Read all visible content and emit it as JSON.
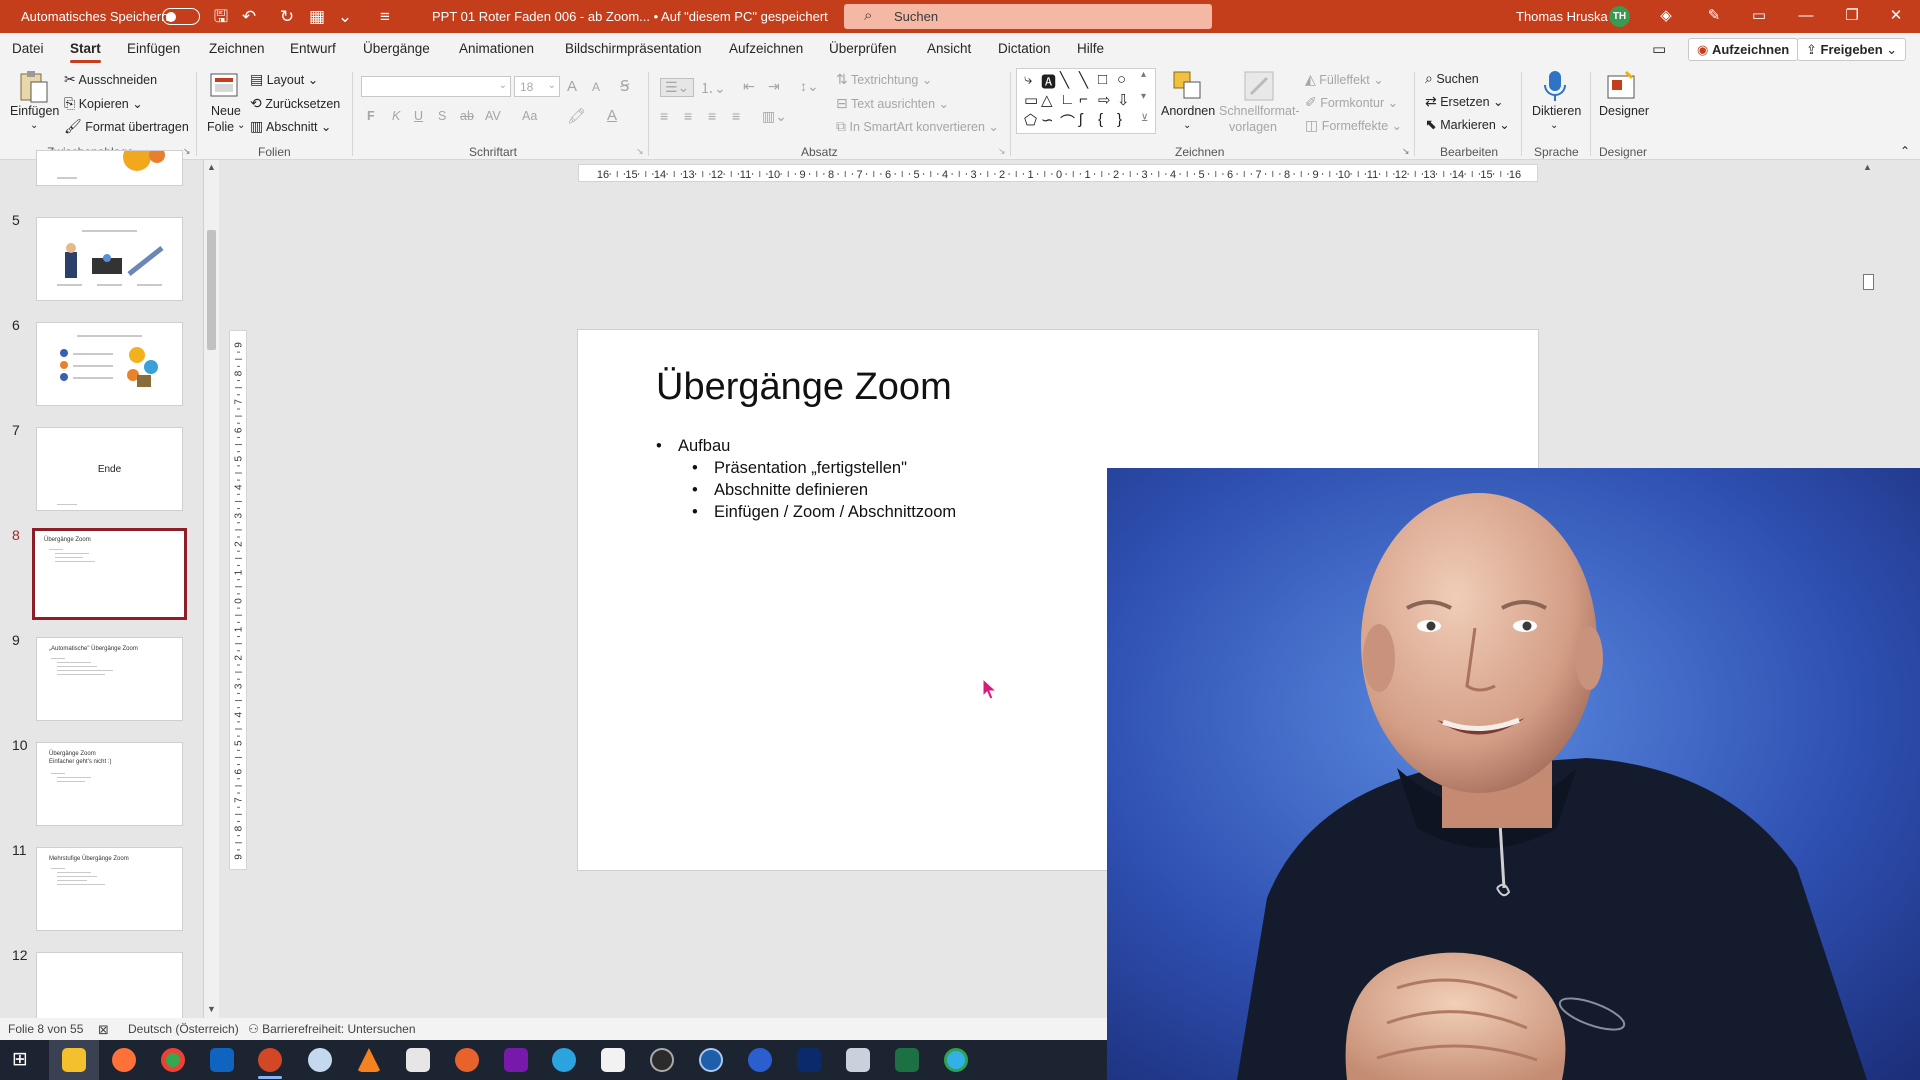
{
  "titlebar": {
    "autosave_label": "Automatisches Speichern",
    "document_title": "PPT 01 Roter Faden 006 - ab Zoom... • Auf \"diesem PC\" gespeichert",
    "search_placeholder": "Suchen",
    "user_name": "Thomas Hruska",
    "user_initials": "TH",
    "accent_color": "#c43e1c"
  },
  "menu": {
    "tabs": [
      "Datei",
      "Start",
      "Einfügen",
      "Zeichnen",
      "Entwurf",
      "Übergänge",
      "Animationen",
      "Bildschirmpräsentation",
      "Aufzeichnen",
      "Überprüfen",
      "Ansicht",
      "Dictation",
      "Hilfe"
    ],
    "active_tab": "Start",
    "record_button": "Aufzeichnen",
    "share_button": "Freigeben"
  },
  "ribbon": {
    "clipboard": {
      "paste": "Einfügen",
      "cut": "Ausschneiden",
      "copy": "Kopieren",
      "format_painter": "Format übertragen",
      "group": "Zwischenablage"
    },
    "slides": {
      "new_slide_1": "Neue",
      "new_slide_2": "Folie",
      "layout": "Layout",
      "reset": "Zurücksetzen",
      "section": "Abschnitt",
      "group": "Folien"
    },
    "font": {
      "size": "18",
      "bold": "F",
      "italic": "K",
      "underline": "U",
      "shadow": "S",
      "strike": "ab",
      "spacing": "AV",
      "case": "Aa",
      "grow": "A",
      "shrink": "A",
      "group": "Schriftart"
    },
    "paragraph": {
      "text_direction": "Textrichtung",
      "align_text": "Text ausrichten",
      "smartart": "In SmartArt konvertieren",
      "group": "Absatz"
    },
    "drawing": {
      "arrange": "Anordnen",
      "quick_styles_1": "Schnellformat-",
      "quick_styles_2": "vorlagen",
      "fill": "Fülleffekt",
      "outline": "Formkontur",
      "effects": "Formeffekte",
      "group": "Zeichnen"
    },
    "editing": {
      "find": "Suchen",
      "replace": "Ersetzen",
      "select": "Markieren",
      "group": "Bearbeiten"
    },
    "voice": {
      "dictate": "Diktieren",
      "group": "Sprache"
    },
    "designer": {
      "label": "Designer",
      "group": "Designer"
    }
  },
  "thumbnails": {
    "numbers": [
      "5",
      "6",
      "7",
      "8",
      "9",
      "10",
      "11",
      "12"
    ],
    "selected_index": 3,
    "slide7_text": "Ende",
    "slide8_title": "Übergänge Zoom",
    "slide9_title": "„Automatische\" Übergänge Zoom",
    "slide10_title": "Übergänge Zoom",
    "slide10_sub": "Einfacher geht's nicht :)",
    "slide11_title": "Mehrstufige Übergänge Zoom"
  },
  "ruler": {
    "h_ticks": [
      "16",
      "15",
      "14",
      "13",
      "12",
      "11",
      "10",
      "9",
      "8",
      "7",
      "6",
      "5",
      "4",
      "3",
      "2",
      "1",
      "0",
      "1",
      "2",
      "3",
      "4",
      "5",
      "6",
      "7",
      "8",
      "9",
      "10",
      "11",
      "12",
      "13",
      "14",
      "15",
      "16"
    ],
    "v_ticks": [
      "9",
      "8",
      "7",
      "6",
      "5",
      "4",
      "3",
      "2",
      "1",
      "0",
      "1",
      "2",
      "3",
      "4",
      "5",
      "6",
      "7",
      "8",
      "9"
    ]
  },
  "slide": {
    "title": "Übergänge Zoom",
    "bullet1": "Aufbau",
    "sub1": "Präsentation „fertigstellen\"",
    "sub2": "Abschnitte definieren",
    "sub3": "Einfügen / Zoom / Abschnittzoom"
  },
  "statusbar": {
    "slide_info": "Folie 8 von 55",
    "language": "Deutsch (Österreich)",
    "accessibility": "Barrierefreiheit: Untersuchen"
  }
}
